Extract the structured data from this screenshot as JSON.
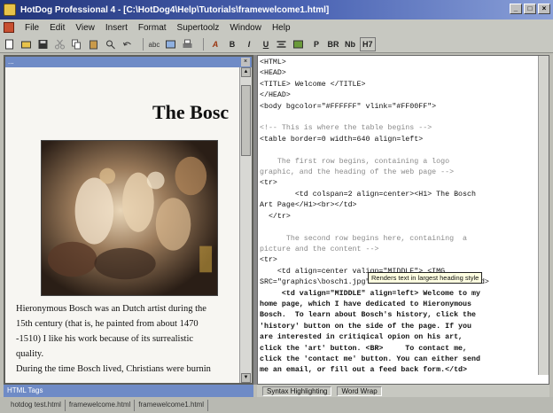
{
  "window": {
    "title": "HotDog Professional 4 - [C:\\HotDog4\\Help\\Tutorials\\framewelcome1.html]"
  },
  "menu": [
    "File",
    "Edit",
    "View",
    "Insert",
    "Format",
    "Supertoolz",
    "Window",
    "Help"
  ],
  "toolbar": {
    "buttons": [
      "A",
      "B",
      "I",
      "U",
      "P",
      "BR",
      "Nb",
      "H7"
    ]
  },
  "preview_pane": {
    "caption": "...",
    "heading": "The Bosc",
    "paragraphs": [
      "Hieronymous Bosch was an Dutch artist during the",
      "15th century (that is, he painted from about 1470",
      "-1510) I like his work because of its surrealistic",
      "quality.",
      "During the time Bosch lived, Christians were burnin"
    ]
  },
  "tags_bar": {
    "label": "HTML Tags"
  },
  "editor": {
    "tooltip": "Renders text in largest heading style",
    "lines": [
      [
        {
          "t": "<HTML>",
          "c": "tag"
        }
      ],
      [
        {
          "t": "<HEAD>",
          "c": "tag"
        }
      ],
      [
        {
          "t": "<TITLE> Welcome </TITLE>",
          "c": "tag"
        }
      ],
      [
        {
          "t": "</HEAD>",
          "c": "tag"
        }
      ],
      [
        {
          "t": "<body bgcolor=\"#FFFFFF\" vlink=\"#FF00FF\">",
          "c": "tag"
        }
      ],
      [
        {
          "t": "",
          "c": "tag"
        }
      ],
      [
        {
          "t": "<!-- This is where the table begins -->",
          "c": "comment"
        }
      ],
      [
        {
          "t": "<table border=0 width=640 align=left>",
          "c": "tag"
        }
      ],
      [
        {
          "t": "",
          "c": "tag"
        }
      ],
      [
        {
          "t": "    The first row begins, containing a logo",
          "c": "comment"
        }
      ],
      [
        {
          "t": "graphic, and the heading of the web page -->",
          "c": "comment"
        }
      ],
      [
        {
          "t": "<tr>",
          "c": "tag"
        }
      ],
      [
        {
          "t": "        <td colspan=2 align=center><H1> The Bosch",
          "c": "tag"
        }
      ],
      [
        {
          "t": "Art Page</H1><br></td>",
          "c": "tag"
        }
      ],
      [
        {
          "t": "  </tr>",
          "c": "tag"
        }
      ],
      [
        {
          "t": "",
          "c": "tag"
        }
      ],
      [
        {
          "t": "      The second row begins here, containing  a",
          "c": "comment"
        }
      ],
      [
        {
          "t": "picture and the content -->",
          "c": "comment"
        }
      ],
      [
        {
          "t": "<tr>",
          "c": "tag"
        }
      ],
      [
        {
          "t": "    <td align=center valign=\"MIDDLE\"> <IMG",
          "c": "tag"
        }
      ],
      [
        {
          "t": "SRC=\"graphics\\bosch1.jpg\" HEIGHT=220 WIDTH=250></td>",
          "c": "tag"
        }
      ],
      [
        {
          "t": "     <td valign=\"MIDDLE\" align=left> Welcome to my",
          "c": "bold"
        }
      ],
      [
        {
          "t": "home page, which I have dedicated to Hieronymous",
          "c": "bold"
        }
      ],
      [
        {
          "t": "Bosch.  To learn about Bosch's history, click the",
          "c": "bold"
        }
      ],
      [
        {
          "t": "'history' button on the side of the page. If you",
          "c": "bold"
        }
      ],
      [
        {
          "t": "are interested in critiqical opion on his art,",
          "c": "bold"
        }
      ],
      [
        {
          "t": "click the 'art' button. <BR>     To contact me,",
          "c": "bold"
        }
      ],
      [
        {
          "t": "click the 'contact me' button. You can either send",
          "c": "bold"
        }
      ],
      [
        {
          "t": "me an email, or fill out a feed back form.</td>",
          "c": "bold"
        }
      ]
    ]
  },
  "editor_status": {
    "syntax": "Syntax Highlighting",
    "wordwrap": "Word Wrap"
  },
  "doc_tabs": [
    "hotdog test.html",
    "framewelcome.html",
    "framewelcome1.html"
  ],
  "colors": {
    "title_gradient_start": "#23357a",
    "pane_caption": "#6f8bc6"
  }
}
